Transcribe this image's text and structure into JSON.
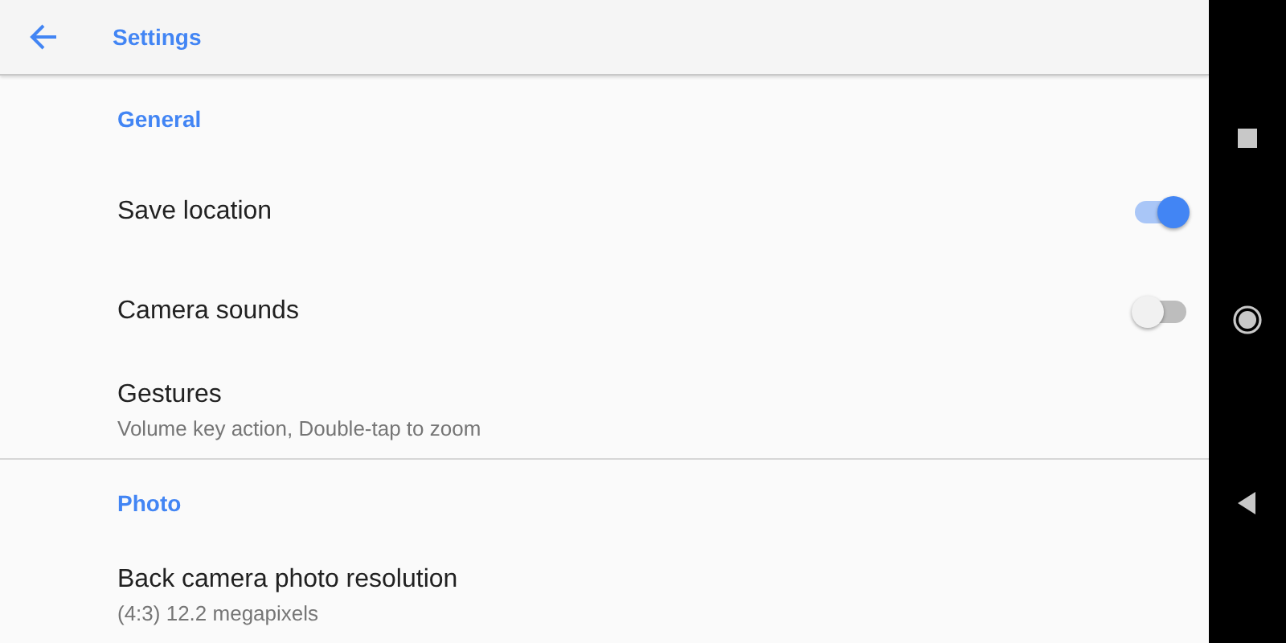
{
  "app_bar": {
    "title": "Settings"
  },
  "sections": [
    {
      "header": "General",
      "rows": [
        {
          "kind": "toggle",
          "title": "Save location",
          "on": true
        },
        {
          "kind": "toggle",
          "title": "Camera sounds",
          "on": false
        },
        {
          "kind": "link",
          "title": "Gestures",
          "subtitle": "Volume key action, Double-tap to zoom"
        }
      ]
    },
    {
      "header": "Photo",
      "rows": [
        {
          "kind": "link",
          "title": "Back camera photo resolution",
          "subtitle": "(4:3) 12.2 megapixels"
        }
      ]
    }
  ]
}
